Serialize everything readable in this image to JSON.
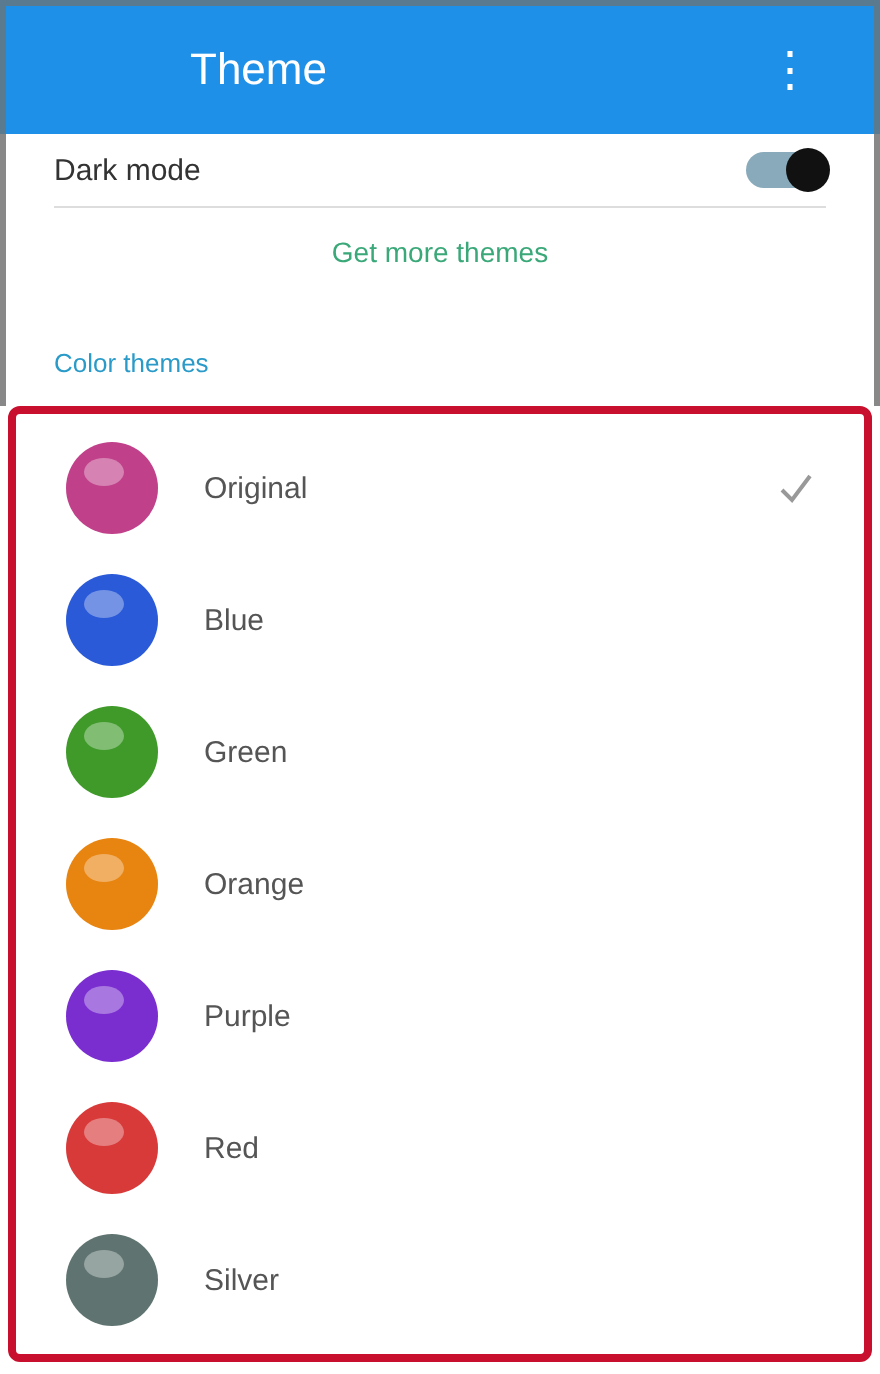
{
  "app_bar": {
    "title": "Theme",
    "menu": "⋮"
  },
  "top_setting": {
    "label": "Dark mode",
    "on": true
  },
  "link": "Get more themes",
  "section_header": "Color themes",
  "themes": [
    {
      "name": "Original",
      "color": "#c0408a",
      "selected": true
    },
    {
      "name": "Blue",
      "color": "#2a5ad8",
      "selected": false
    },
    {
      "name": "Green",
      "color": "#3f9a2a",
      "selected": false
    },
    {
      "name": "Orange",
      "color": "#e88410",
      "selected": false
    },
    {
      "name": "Purple",
      "color": "#7a2ed0",
      "selected": false
    },
    {
      "name": "Red",
      "color": "#d83a3a",
      "selected": false
    },
    {
      "name": "Silver",
      "color": "#5f7470",
      "selected": false
    }
  ]
}
